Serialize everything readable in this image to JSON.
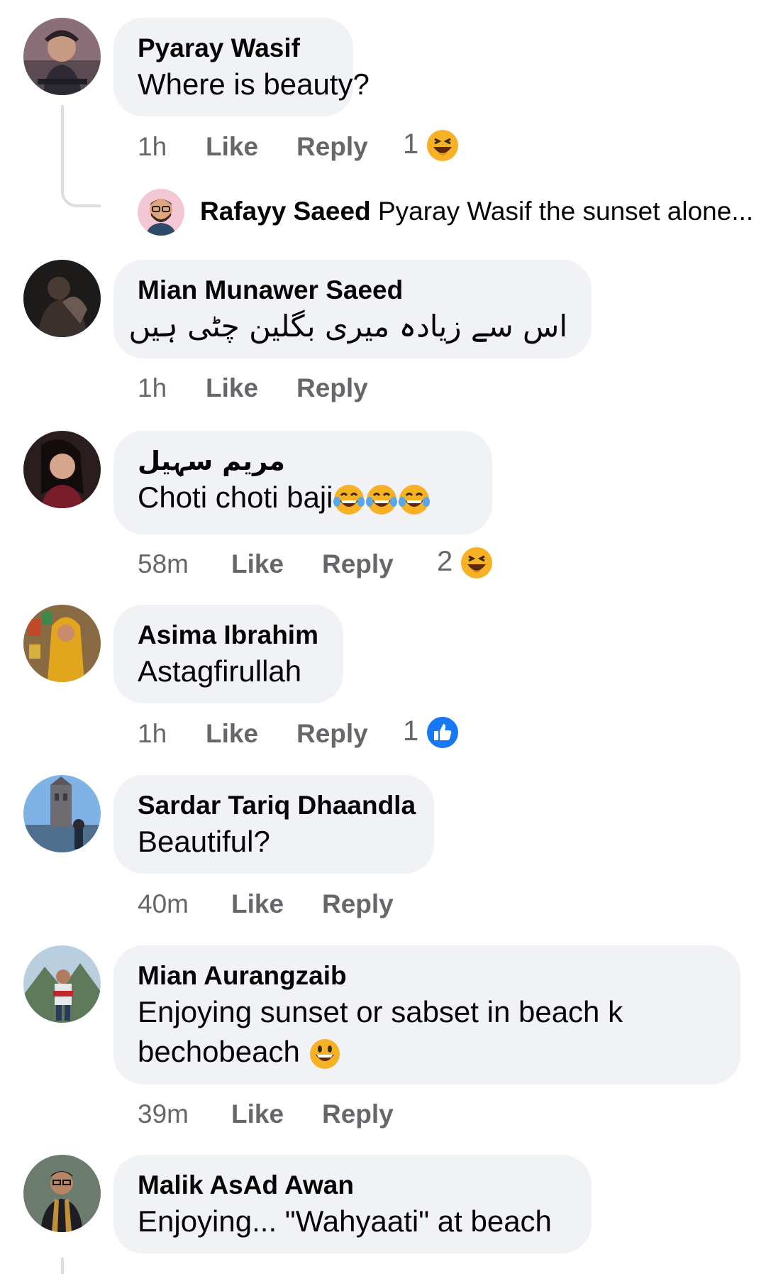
{
  "comments": [
    {
      "author": "Pyaray Wasif",
      "text": "Where is beauty?",
      "time": "1h",
      "like_label": "Like",
      "reply_label": "Reply",
      "reaction_count": "1",
      "reaction_icon": "laughing-emoji-icon",
      "avatar_icon": "avatar-photo-man"
    },
    {
      "author": "Mian Munawer Saeed",
      "text": "اس سے زیادہ میری بگلین چٹی ہیں",
      "time": "1h",
      "like_label": "Like",
      "reply_label": "Reply",
      "avatar_icon": "avatar-photo-dark"
    },
    {
      "author": "مریم سہیل",
      "text": "Choti choti baji",
      "time": "58m",
      "like_label": "Like",
      "reply_label": "Reply",
      "reaction_count": "2",
      "reaction_icon": "laughing-emoji-icon",
      "avatar_icon": "avatar-photo-woman"
    },
    {
      "author": "Asima Ibrahim",
      "text": "Astagfirullah",
      "time": "1h",
      "like_label": "Like",
      "reply_label": "Reply",
      "reaction_count": "1",
      "reaction_icon": "like-thumb-icon",
      "avatar_icon": "avatar-photo-woman-yellow"
    },
    {
      "author": "Sardar Tariq Dhaandla",
      "text": "Beautiful?",
      "time": "40m",
      "like_label": "Like",
      "reply_label": "Reply",
      "avatar_icon": "avatar-photo-bridge"
    },
    {
      "author": "Mian Aurangzaib",
      "text": "Enjoying sunset or sabset in beach k bechobeach",
      "time": "39m",
      "like_label": "Like",
      "reply_label": "Reply",
      "avatar_icon": "avatar-photo-mountains"
    },
    {
      "author": "Malik AsAd Awan",
      "text": "Enjoying... \"Wahyaati\" at beach",
      "avatar_icon": "avatar-photo-man-scarf"
    }
  ],
  "reply_preview": {
    "author": "Rafayy Saeed",
    "text": "Pyaray Wasif the sunset alone..."
  },
  "colors": {
    "bubble": "#f0f2f5",
    "meta_text": "#65676b",
    "like_blue": "#1877f2",
    "emoji_yellow": "#f7b125"
  }
}
